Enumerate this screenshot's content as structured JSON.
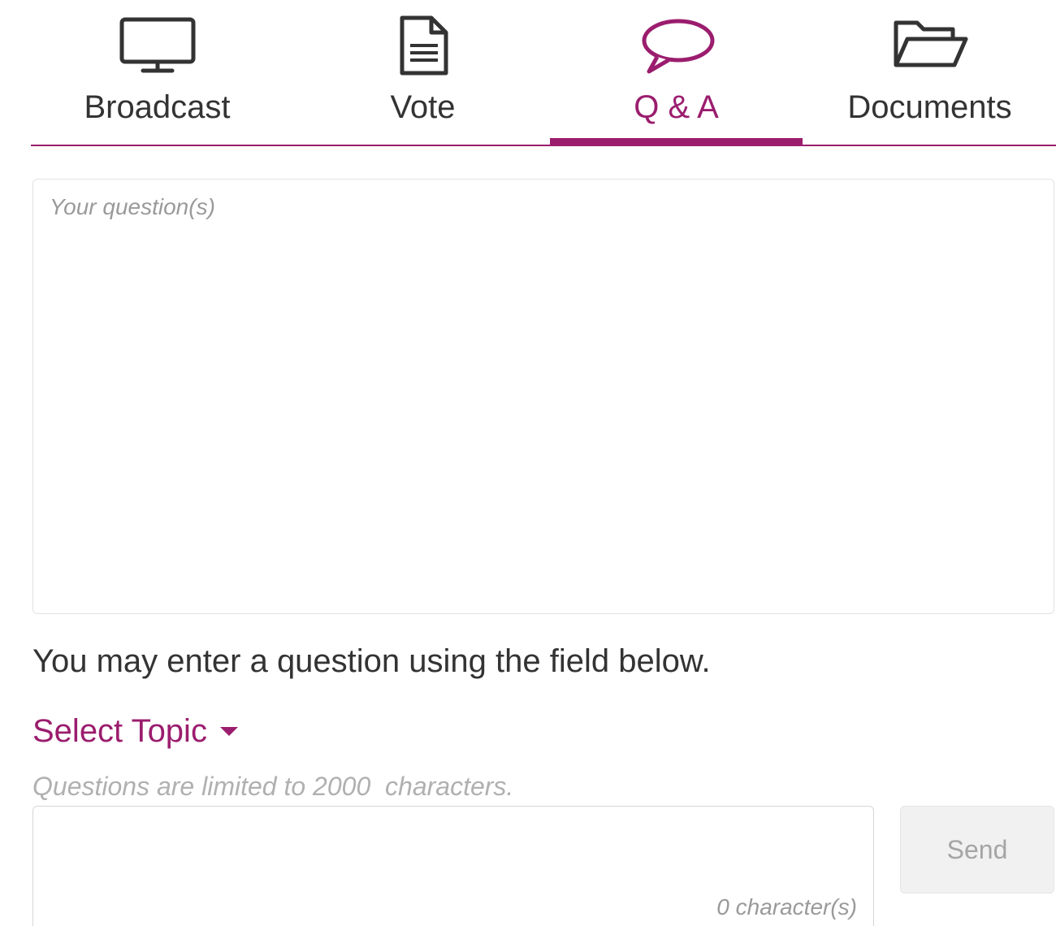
{
  "tabs": [
    {
      "id": "broadcast",
      "label": "Broadcast",
      "icon": "monitor-icon",
      "active": false
    },
    {
      "id": "vote",
      "label": "Vote",
      "icon": "document-icon",
      "active": false
    },
    {
      "id": "qa",
      "label": "Q & A",
      "icon": "speech-bubble-icon",
      "active": true
    },
    {
      "id": "documents",
      "label": "Documents",
      "icon": "folder-open-icon",
      "active": false
    }
  ],
  "questions_area": {
    "placeholder": "Your question(s)"
  },
  "instruction": "You may enter a question using the field below.",
  "topic_select": {
    "label": "Select Topic"
  },
  "limit_note": "Questions are limited to 2000  characters.",
  "question_input": {
    "value": "",
    "char_count": "0 character(s)"
  },
  "send_button": {
    "label": "Send",
    "enabled": false
  },
  "colors": {
    "accent": "#9b1d6e",
    "text": "#333333",
    "muted": "#9a9a9a"
  }
}
